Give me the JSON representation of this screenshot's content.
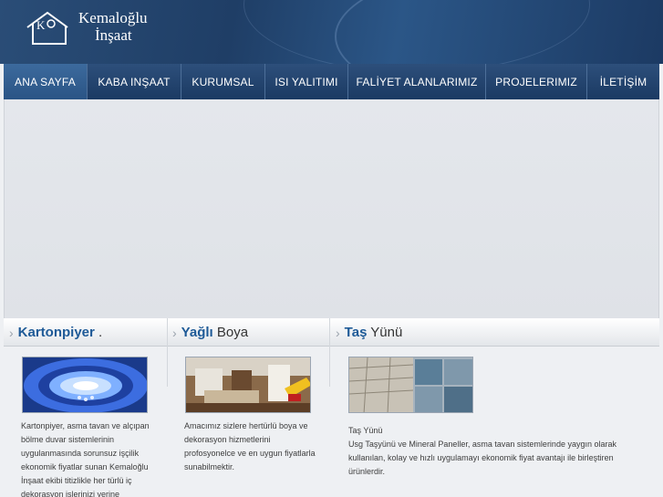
{
  "brand": {
    "line1": "Kemaloğlu",
    "line2": "İnşaat",
    "colors": {
      "header": "#1f3e66",
      "accent": "#1e5a97"
    }
  },
  "nav": [
    {
      "label": "ANA SAYFA",
      "active": true
    },
    {
      "label": "KABA INŞAAT"
    },
    {
      "label": "KURUMSAL"
    },
    {
      "label": "ISI YALITIMI"
    },
    {
      "label": "FALİYET ALANLARIMIZ"
    },
    {
      "label": "PROJELERIMIZ"
    },
    {
      "label": "İLETİŞİM"
    }
  ],
  "columns": [
    {
      "bold": "Kartonpiyer",
      "rest": " .",
      "image": "ceiling-lights-image",
      "text": "Kartonpiyer, asma tavan ve alçıpan bölme duvar sistemlerinin uygulanmasında sorunsuz işçilik ekonomik fiyatlar sunan Kemaloğlu İnşaat ekibi titizlikle her türlü iç dekorasyon işlerinizi yerine"
    },
    {
      "bold": "Yağlı",
      "rest": " Boya",
      "image": "living-room-image",
      "text": "Amacımız sizlere hertürlü boya ve dekorasyon hizmetlerini profosyonelce ve en uygun fiyatlarla sunabilmektir."
    },
    {
      "bold": "Taş",
      "rest": " Yünü",
      "image": "panels-image",
      "title": "Taş Yünü",
      "text": "Usg Taşyünü ve Mineral Paneller, asma tavan sistemlerinde yaygın olarak kullanılan, kolay ve hızlı uygulamayı ekonomik fiyat avantajı ile birleştiren ürünlerdir."
    }
  ]
}
